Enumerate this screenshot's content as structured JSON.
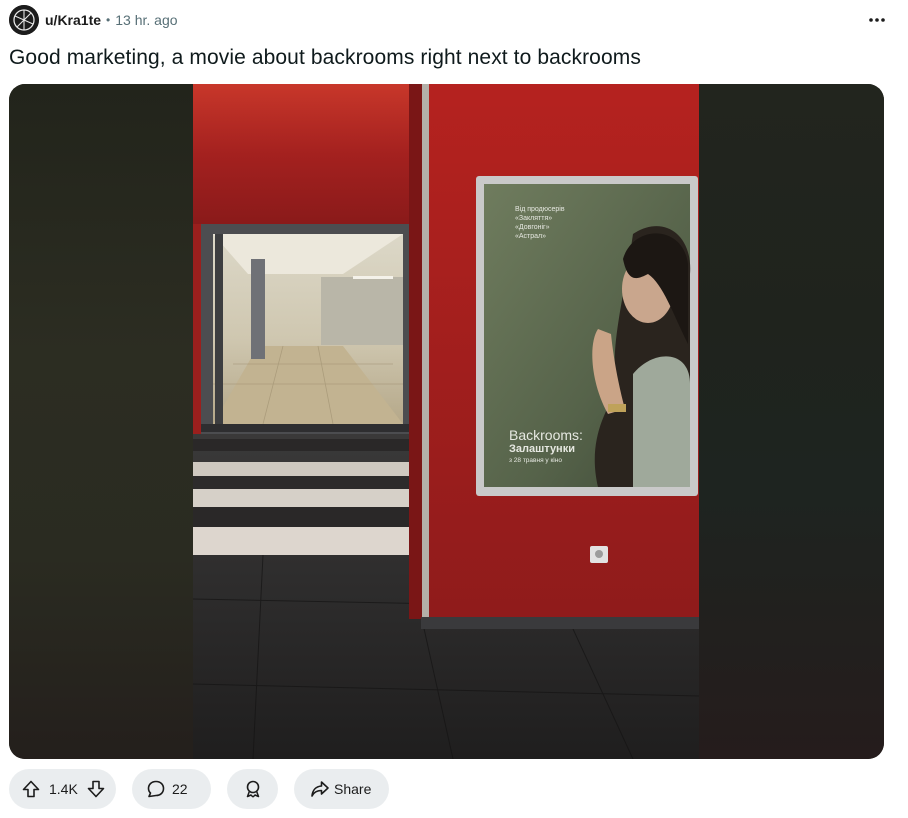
{
  "post": {
    "username": "u/Kra1te",
    "separator": "•",
    "time": "13 hr. ago",
    "title": "Good marketing, a movie about backrooms right next to backrooms"
  },
  "poster": {
    "credit_lines": [
      "Від продюсерів",
      "«Закляття»",
      "«Довгоніг»",
      "«Астрал»"
    ],
    "film_title": "Backrooms:",
    "film_subtitle": "Залаштунки",
    "release": "з 28 травня у кіно"
  },
  "actions": {
    "vote_count": "1.4K",
    "comment_count": "22",
    "share_label": "Share"
  },
  "icons": [
    "avatar-icon",
    "more-options-icon",
    "upvote-icon",
    "downvote-icon",
    "comment-icon",
    "award-icon",
    "share-icon"
  ]
}
